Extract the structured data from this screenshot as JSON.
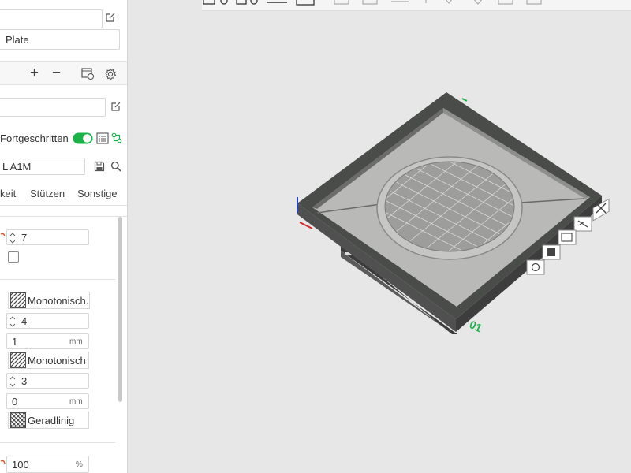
{
  "panel": {
    "top_field_value": "",
    "plate_label": "Plate",
    "add_symbol": "+",
    "remove_symbol": "−",
    "process_name_value": "",
    "advanced_label": "Fortgeschritten",
    "advanced_enabled": true,
    "printer_preset_value": "L A1M",
    "tabs": [
      "keit",
      "Stützen",
      "Sonstige"
    ],
    "wall_loops_value": "7",
    "top_pattern_value": "Monotonisch...",
    "top_layers_value": "4",
    "top_thickness_value": "1",
    "top_thickness_unit": "mm",
    "bottom_pattern_value": "Monotonisch",
    "bottom_layers_value": "3",
    "bottom_thickness_value": "0",
    "bottom_thickness_unit": "mm",
    "infill_pattern_value": "Geradlinig",
    "infill_density_value": "100",
    "infill_density_unit": "%"
  },
  "toolbar": {
    "icons": [
      "orient-icon",
      "arrange-icon",
      "layer-icon",
      "split-icon",
      "copy-icon",
      "paste-icon",
      "plate-icon",
      "add-part-icon",
      "lower-icon",
      "support-icon",
      "brim-icon",
      "seam-icon"
    ]
  },
  "viewport": {
    "plate_number": "01",
    "plate_tools": [
      "close-icon",
      "lock-icon",
      "auto-orient-icon",
      "arrange-plate-icon",
      "plate-settings-icon"
    ],
    "colors": {
      "background": "#e7e7e7",
      "model_wall": "#4a4c4a",
      "model_floor": "#b9b9b7",
      "plate_number": "#1db34a",
      "accent_toggle": "#19b34a"
    }
  }
}
